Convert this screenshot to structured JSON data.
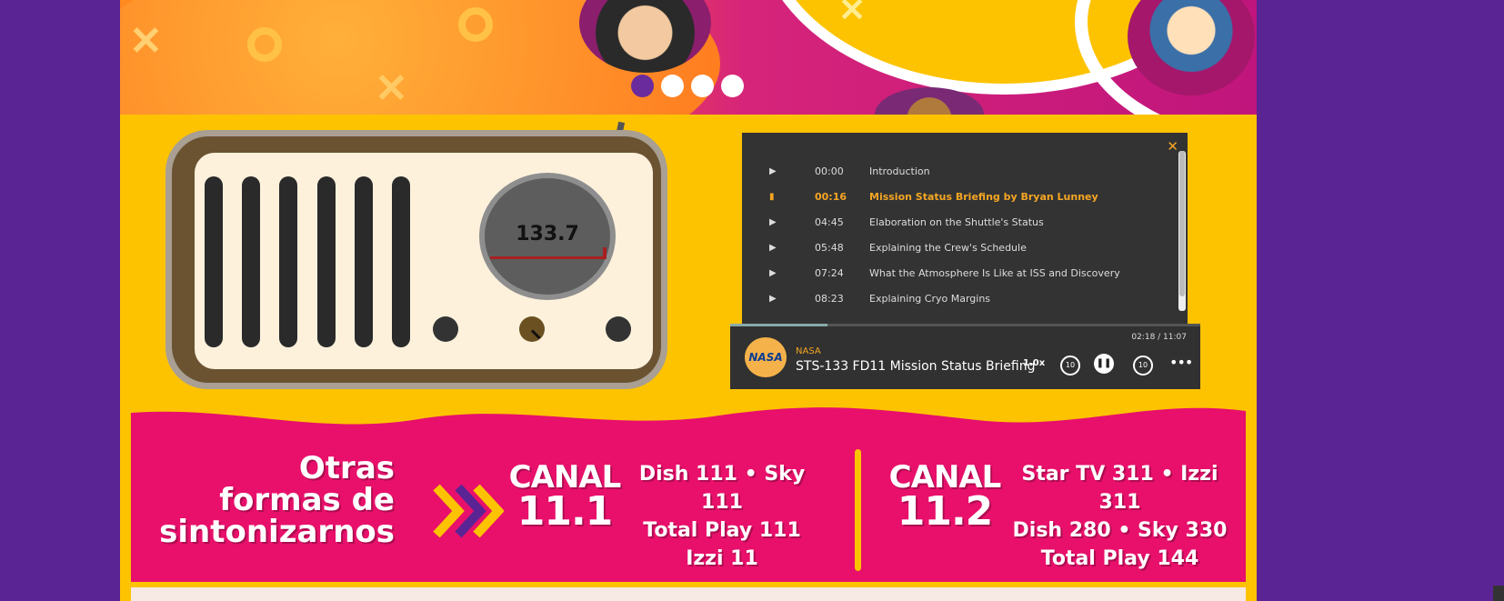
{
  "carousel": {
    "slides": 4,
    "active_index": 0
  },
  "radio": {
    "frequency": "133.7"
  },
  "playlist": {
    "close_label": "✕",
    "items": [
      {
        "time": "00:00",
        "title": "Introduction",
        "active": false
      },
      {
        "time": "00:16",
        "title": "Mission Status Briefing by Bryan Lunney",
        "active": true
      },
      {
        "time": "04:45",
        "title": "Elaboration on the Shuttle's Status",
        "active": false
      },
      {
        "time": "05:48",
        "title": "Explaining the Crew's Schedule",
        "active": false
      },
      {
        "time": "07:24",
        "title": "What the Atmosphere Is Like at ISS and Discovery",
        "active": false
      },
      {
        "time": "08:23",
        "title": "Explaining Cryo Margins",
        "active": false
      }
    ]
  },
  "player": {
    "logo_text": "NASA",
    "publisher": "NASA",
    "title": "STS-133 FD11 Mission Status Briefing",
    "time": "02:18 / 11:07",
    "progress": 0.207,
    "speed": "1.0x",
    "back_label": "10",
    "forward_label": "10"
  },
  "banner": {
    "headline": [
      "Otras",
      "formas de",
      "sintonizarnos"
    ],
    "channel1": {
      "name": [
        "CANAL",
        "11.1"
      ],
      "info": [
        "Dish 111 • Sky 111",
        "Total Play 111",
        "Izzi 11"
      ]
    },
    "channel2": {
      "name": [
        "CANAL",
        "11.2"
      ],
      "info": [
        "Star TV 311 • Izzi 311",
        "Dish 280 • Sky 330",
        "Total Play 144"
      ]
    }
  },
  "colors": {
    "background": "#5b2494",
    "page": "#fdc300",
    "banner": "#e8106b",
    "accent": "#f5a623"
  }
}
